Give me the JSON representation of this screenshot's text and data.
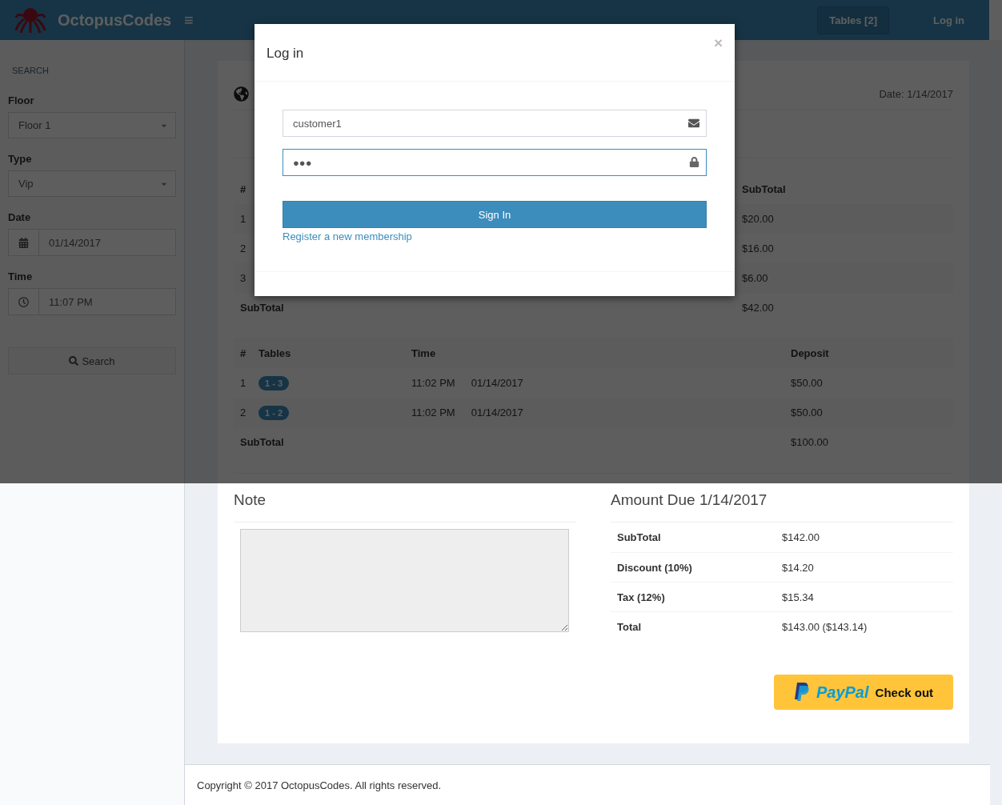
{
  "header": {
    "brand": "OctopusCodes",
    "menu_icon": "≡",
    "nav": [
      {
        "label": "Tables [2]",
        "selected": true
      },
      {
        "label": "Log in",
        "selected": false
      }
    ]
  },
  "sidebar": {
    "heading": "SEARCH",
    "fields": [
      {
        "kind": "select",
        "label": "Floor",
        "value": "Floor 1"
      },
      {
        "kind": "select",
        "label": "Type",
        "value": "Vip"
      },
      {
        "kind": "date",
        "label": "Date",
        "value": "01/14/2017"
      },
      {
        "kind": "time",
        "label": "Time",
        "value": "11:07 PM"
      }
    ],
    "search_button": "Search"
  },
  "invoice": {
    "date": "Date: 1/14/2017",
    "items": {
      "columns": [
        "#",
        "SubTotal"
      ],
      "rows": [
        [
          "1",
          "$20.00"
        ],
        [
          "2",
          "$16.00"
        ],
        [
          "3",
          "$6.00"
        ]
      ],
      "total_label": "SubTotal",
      "total": "$42.00"
    },
    "bookings": {
      "columns": [
        "#",
        "Tables",
        "Time",
        "Deposit"
      ],
      "rows": [
        {
          "index": "1",
          "table": "1 - 3",
          "time": "11:02 PM",
          "date": "01/14/2017",
          "deposit": "$50.00"
        },
        {
          "index": "2",
          "table": "1 - 2",
          "time": "11:02 PM",
          "date": "01/14/2017",
          "deposit": "$50.00"
        }
      ],
      "total_label": "SubTotal",
      "total": "$100.00"
    },
    "note": {
      "title": "Note"
    },
    "amount_due": {
      "title": "Amount Due 1/14/2017",
      "rows": [
        {
          "label": "SubTotal",
          "value": "$142.00"
        },
        {
          "label": "Discount (10%)",
          "value": "$14.20"
        },
        {
          "label": "Tax (12%)",
          "value": "$15.34"
        },
        {
          "label": "Total",
          "value": "$143.00 ($143.14)"
        }
      ]
    },
    "paypal": {
      "logo": "PayPal",
      "label": "Check out"
    }
  },
  "footer": "Copyright © 2017 OctopusCodes. All rights reserved.",
  "modal": {
    "title": "Log in",
    "close": "×",
    "username": "customer1",
    "password": "●●●",
    "sign_in": "Sign In",
    "register": "Register a new membership"
  }
}
